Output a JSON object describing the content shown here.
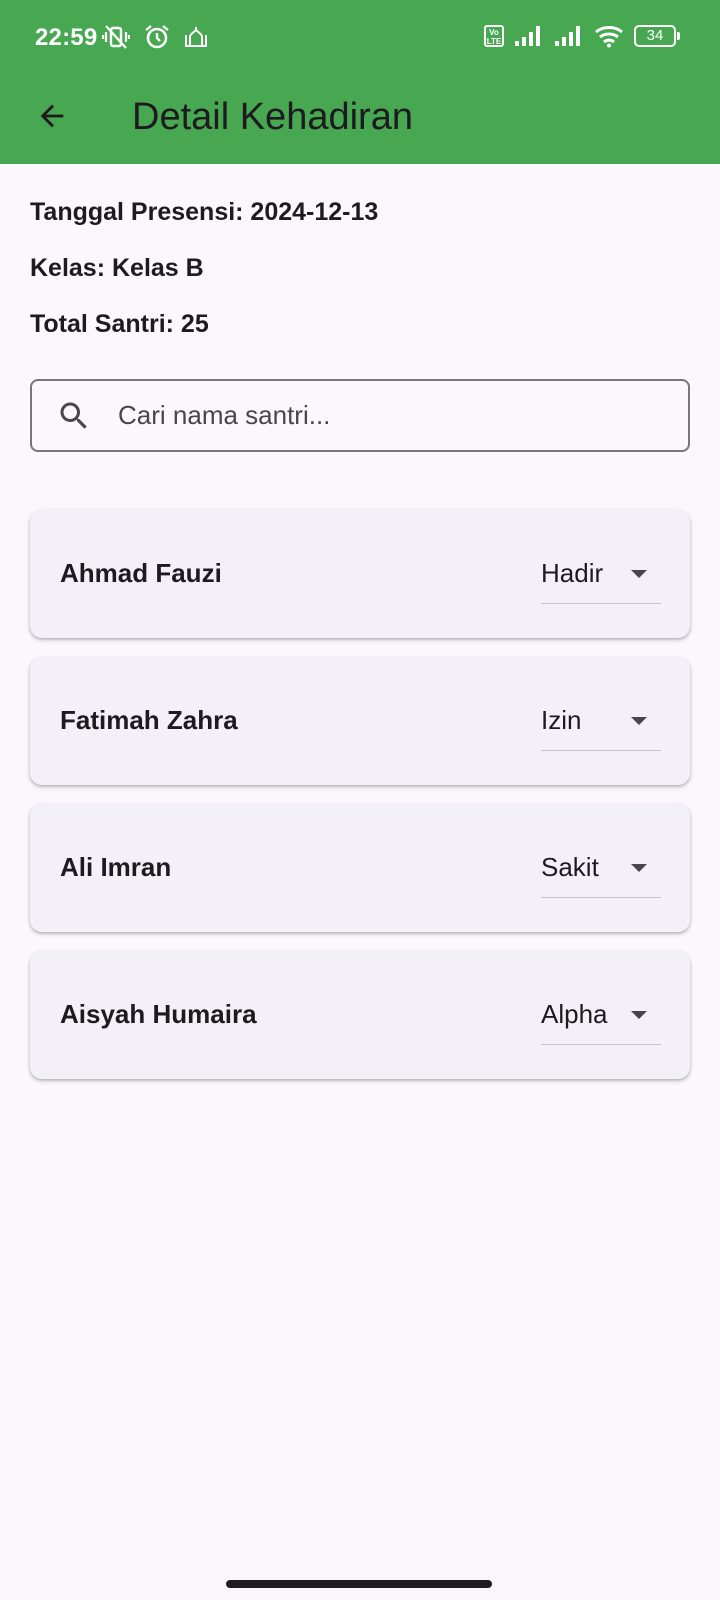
{
  "status_bar": {
    "time": "22:59",
    "battery": "34",
    "volte_label": "Vo LTE",
    "icons": [
      "vibrate-off-icon",
      "alarm-icon",
      "mosque-icon",
      "volte-icon",
      "signal-icon",
      "signal-icon",
      "wifi-icon",
      "battery-icon"
    ]
  },
  "app_bar": {
    "title": "Detail Kehadiran",
    "back_icon": "arrow-back-icon",
    "color": "#47a851"
  },
  "info": {
    "date": "Tanggal Presensi: 2024-12-13",
    "class": "Kelas: Kelas B",
    "total": "Total Santri: 25"
  },
  "search": {
    "placeholder": "Cari nama santri...",
    "value": "",
    "icon": "search-icon"
  },
  "students": [
    {
      "name": "Ahmad Fauzi",
      "status": "Hadir"
    },
    {
      "name": "Fatimah Zahra",
      "status": "Izin"
    },
    {
      "name": "Ali Imran",
      "status": "Sakit"
    },
    {
      "name": "Aisyah Humaira",
      "status": "Alpha"
    }
  ],
  "colors": {
    "background": "#fcf6fd",
    "card": "#f4f0f7",
    "text": "#1d1b20"
  }
}
